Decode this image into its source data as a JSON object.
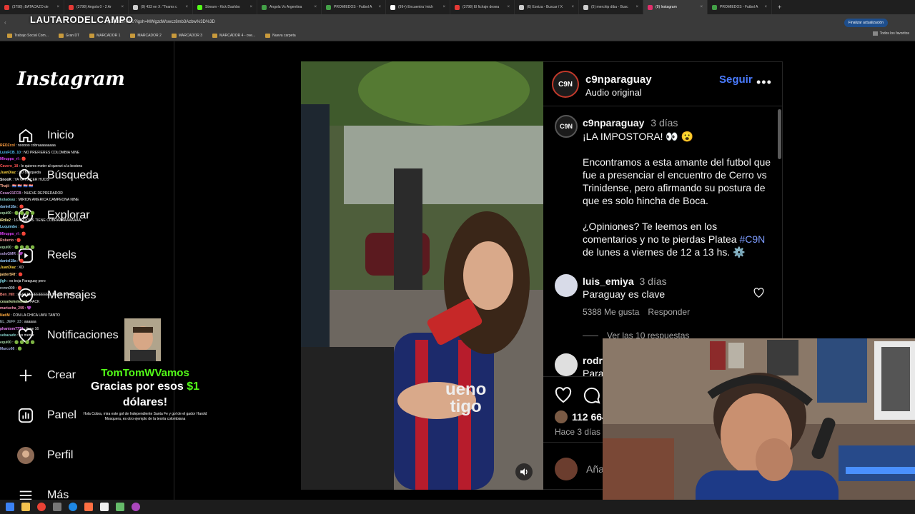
{
  "browser": {
    "tabs": [
      {
        "label": "(3798) ¡BATACAZO de",
        "color": "#e53935"
      },
      {
        "label": "(3798) Angola 0 - 2 Ar",
        "color": "#e53935"
      },
      {
        "label": "(9) 433 en X: \"Teams c",
        "color": "#cccccc"
      },
      {
        "label": "Stream - Kick Dashbo",
        "color": "#53fc18"
      },
      {
        "label": "Angola Vs Argentina",
        "color": "#43a047"
      },
      {
        "label": "PROMIEDOS - Futbol A",
        "color": "#43a047"
      },
      {
        "label": "(99+) Encuentra 'mich",
        "color": "#ffffff"
      },
      {
        "label": "(3798) El fichaje desea",
        "color": "#e53935"
      },
      {
        "label": "(6) Ezeiza - Buscar / X",
        "color": "#cccccc"
      },
      {
        "label": "(5) merchip dibu - Busc",
        "color": "#cccccc"
      },
      {
        "label": "(9) Instagram",
        "color": "#e1306c",
        "active": true
      },
      {
        "label": "PROMIEDOS - Futbol A",
        "color": "#43a047"
      }
    ],
    "url": "Q7qvnGFGfX/?igsh=MWgzdWswcz8mb3Azbw%3D%3D",
    "update_button": "Finalizar actualización",
    "bookmarks": [
      "Trabajo Social Com...",
      "Gran DT",
      "MARCADOR 1",
      "MARCADOR 2",
      "MARCADOR 3",
      "MARCADOR 4 - ove...",
      "Nueva carpeta"
    ],
    "all_bookmarks": "Todos los favoritos"
  },
  "watermark": "LAUTARODELCAMPO",
  "instagram": {
    "logo": "Instagram",
    "nav": [
      {
        "label": "Inicio",
        "icon": "home-icon"
      },
      {
        "label": "Búsqueda",
        "icon": "search-icon"
      },
      {
        "label": "Explorar",
        "icon": "compass-icon"
      },
      {
        "label": "Reels",
        "icon": "reels-icon"
      },
      {
        "label": "Mensajes",
        "icon": "messenger-icon"
      },
      {
        "label": "Notificaciones",
        "icon": "heart-icon"
      },
      {
        "label": "Crear",
        "icon": "plus-icon"
      },
      {
        "label": "Panel",
        "icon": "chart-icon"
      },
      {
        "label": "Perfil",
        "icon": "avatar-icon"
      },
      {
        "label": "Más",
        "icon": "menu-icon"
      }
    ],
    "post": {
      "author": "c9nparaguay",
      "avatar_text": "C9N",
      "audio": "Audio original",
      "follow": "Seguir",
      "caption_author": "c9nparaguay",
      "caption_time": "3 días",
      "caption_line1": "¡LA IMPOSTORA! 👀 😮",
      "caption_p2": "Encontramos a esta amante del futbol que fue a presenciar el encuentro de Cerro vs Trinidense, pero afirmando su postura de que es solo hincha de Boca.",
      "caption_p3a": "¿Opiniones? Te leemos en los comentarios y no te pierdas Platea ",
      "caption_hashtag": "#C9N",
      "caption_p3b": " de lunes a viernes de 12 a 13 hs. ⚙️",
      "comment1": {
        "user": "luis_emiya",
        "time": "3 días",
        "text": "Paraguay es clave",
        "likes": "5388 Me gusta",
        "reply": "Responder",
        "view_replies": "Ver las 10 respuestas"
      },
      "comment2": {
        "user": "rodr",
        "text": "Parag"
      },
      "likes_count": "112 664",
      "date": "Hace 3 días",
      "add_comment": "Aña"
    }
  },
  "chat": [
    {
      "user": "REDZcol",
      "color": "#ff9e40",
      "text": "nooooo cobraaaaaaaaa"
    },
    {
      "user": "LuisFCB_10",
      "color": "#4fc3f7",
      "text": "NO PREFIERES COLOMBIA NINE"
    },
    {
      "user": "Mlruppo_rl",
      "color": "#e040fb",
      "text": "🔴"
    },
    {
      "user": "Cavero_18",
      "color": "#ff5252",
      "text": "le quieres meter al querari a la bostera"
    },
    {
      "user": "JuanDiaz",
      "color": "#ffd740",
      "text": "XD Busqueda"
    },
    {
      "user": "SnooK",
      "color": "#ffffff",
      "text": "YA VA HACER HIJOS"
    },
    {
      "user": "Thajii",
      "color": "#ffab91",
      "text": "🇵🇾 🇵🇾 🇵🇾 🇵🇾"
    },
    {
      "user": "Cesar21FCB",
      "color": "#ce93d8",
      "text": "NUEVE DEPREDADOR"
    },
    {
      "user": "koladeax",
      "color": "#80cbc4",
      "text": "MIRION AMERICA CAMPEONA NINE"
    },
    {
      "user": "daniel18a",
      "color": "#90caf9",
      "text": "🔴"
    },
    {
      "user": "equi00",
      "color": "#a5d6a7",
      "text": "🟢 🟢 🟢 🟢"
    },
    {
      "user": "iRdle2",
      "color": "#fff59d",
      "text": "16 AÑOOOS TIENE COBRAAAAAAAAAA"
    },
    {
      "user": "Luquimbo",
      "color": "#81d4fa",
      "text": "🔴"
    },
    {
      "user": "Mlruppo_rl",
      "color": "#e040fb",
      "text": "🔴"
    },
    {
      "user": "Roberto",
      "color": "#ef9a9a",
      "text": "🔴"
    },
    {
      "user": "equi00",
      "color": "#a5d6a7",
      "text": "🟢 🟢 🟢 🟢"
    },
    {
      "user": "soloGMR",
      "color": "#b39ddb",
      "text": "💜"
    },
    {
      "user": "daniel18a",
      "color": "#90caf9",
      "text": "🔴"
    },
    {
      "user": "JuanDiaz",
      "color": "#ffd740",
      "text": "XD"
    },
    {
      "user": "jaider5Rf",
      "color": "#ffcc80",
      "text": "🔴"
    },
    {
      "user": "jlgh",
      "color": "#80deea",
      "text": "es troja Paraguay pero"
    },
    {
      "user": "rcmn009",
      "color": "#b0bec5",
      "text": "🔴"
    },
    {
      "user": "Ben_Hilt",
      "color": "#ff8a80",
      "text": "EEEEEEEEEEEEEE TIENE 16 AÑOS"
    },
    {
      "user": "cesarkekekeke9",
      "color": "#c5e1a5",
      "text": "FACK"
    },
    {
      "user": "martucha_299",
      "color": "#f48fb1",
      "text": "💜"
    },
    {
      "user": "NatiM",
      "color": "#ffab40",
      "text": "CON LA CHICA UWU TANTO"
    },
    {
      "user": "EL_JEFF_23",
      "color": "#90a4ae",
      "text": "aaaaaa"
    },
    {
      "user": "phantom7772",
      "color": "#ea80fc",
      "text": "tiene 16"
    },
    {
      "user": "sebazado",
      "color": "#80cbc4",
      "text": "es menor"
    },
    {
      "user": "equi00",
      "color": "#a5d6a7",
      "text": "🟢 🟢 🟢 🟢"
    },
    {
      "user": "Marco66",
      "color": "#9fa8da",
      "text": "🟢"
    }
  ],
  "donation": {
    "name": "TomTomWVamos",
    "line_a": "Gracias por esos ",
    "amount": "$1",
    "line_b": "dólares!",
    "message": "Hola Cobra, mira este gol de Independiente Santa Fe y gol de el gador Harold Mosquera, es otro ejemplo de la teoría colombiana",
    "name_color": "#53fc18"
  },
  "video": {
    "sponsor1": "ueno",
    "sponsor2": "tigo"
  }
}
